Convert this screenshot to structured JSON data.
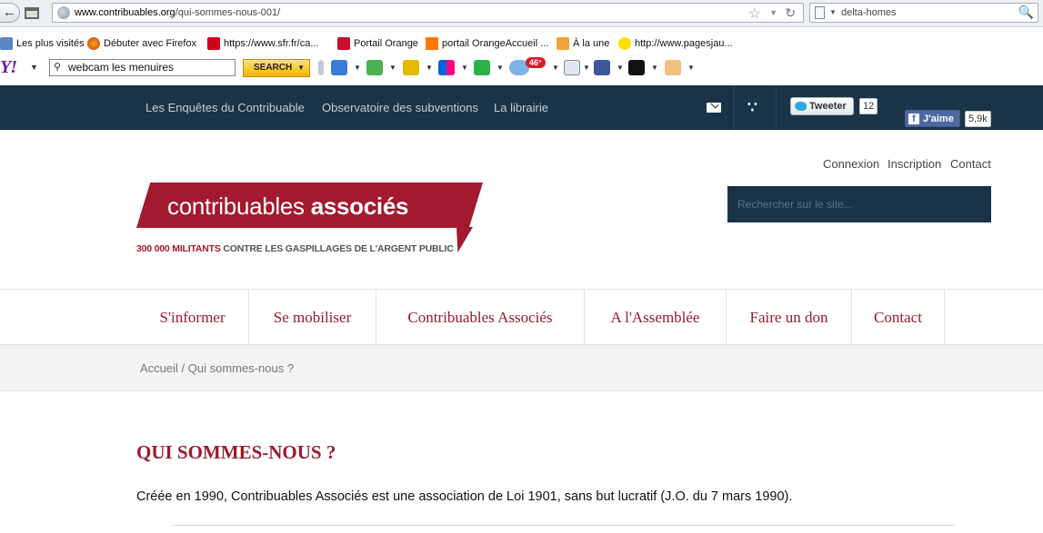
{
  "browser": {
    "url_host": "www.contribuables.org",
    "url_path": "/qui-sommes-nous-001/",
    "search_value": "delta-homes",
    "bookmarks": [
      {
        "label": "Les plus visités",
        "icon": "bookmark-folder-icon"
      },
      {
        "label": "Débuter avec Firefox",
        "icon": "firefox-icon"
      },
      {
        "label": "https://www.sfr.fr/ca...",
        "icon": "sfr-icon"
      },
      {
        "label": "Portail Orange",
        "icon": "orange-wifi-icon"
      },
      {
        "label": "portail OrangeAccueil ...",
        "icon": "orange-square-icon"
      },
      {
        "label": "À la une",
        "icon": "rss-feed-icon"
      },
      {
        "label": "http://www.pagesjau...",
        "icon": "pagesjaunes-icon"
      }
    ],
    "yahoo_toolbar": {
      "logo": "Y!",
      "search_value": "webcam les menuires",
      "search_button": "SEARCH",
      "weather_badge": "46°"
    }
  },
  "site": {
    "top_links": [
      "Les Enquêtes du Contribuable",
      "Observatoire des subventions",
      "La librairie"
    ],
    "tweet_label": "Tweeter",
    "tweet_count": "12",
    "like_label": "J'aime",
    "like_count": "5,9k",
    "account_links": [
      "Connexion",
      "Inscription",
      "Contact"
    ],
    "search_placeholder": "Rechercher sur le site...",
    "logo_word1": "contribuables",
    "logo_word2": "associés",
    "tagline_accent": "300 000 MILITANTS",
    "tagline_rest": " CONTRE LES GASPILLAGES DE L'ARGENT PUBLIC",
    "nav": [
      "S'informer",
      "Se mobiliser",
      "Contribuables Associés",
      "A l'Assemblée",
      "Faire un don",
      "Contact"
    ],
    "breadcrumb": "Accueil / Qui sommes-nous ?",
    "page_title": "QUI SOMMES-NOUS ?",
    "intro": "Créée en 1990, Contribuables Associés est une association de Loi 1901, sans but lucratif (J.O. du 7 mars 1990)."
  },
  "colors": {
    "brand_red": "#a3192e",
    "topbar_navy": "#1a3346"
  }
}
